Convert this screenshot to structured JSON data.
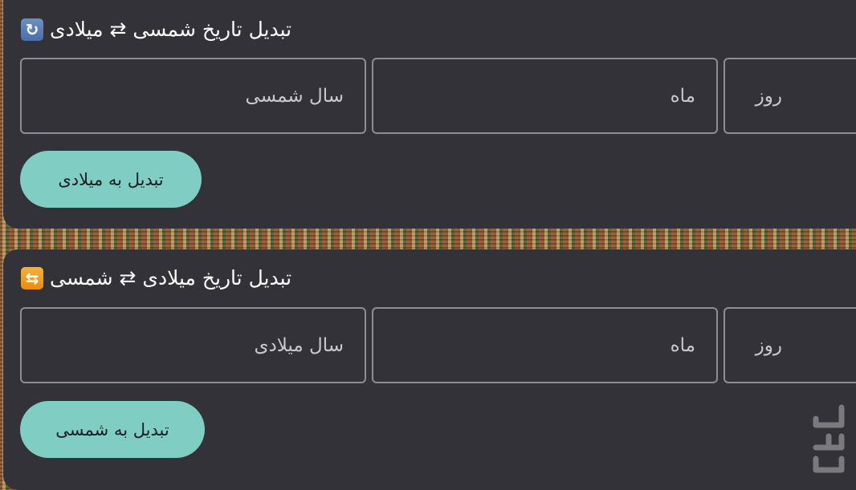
{
  "sections": [
    {
      "title": "تبدیل تاریخ شمسی ⇄ میلادی",
      "icon": "refresh-icon",
      "year_placeholder": "سال شمسی",
      "month_placeholder": "ماه",
      "day_placeholder": "روز",
      "button_label": "تبدیل به میلادی"
    },
    {
      "title": "تبدیل تاریخ میلادی ⇄ شمسی",
      "icon": "repeat-icon",
      "year_placeholder": "سال میلادی",
      "month_placeholder": "ماه",
      "day_placeholder": "روز",
      "button_label": "تبدیل به شمسی"
    }
  ],
  "colors": {
    "card_bg": "#333238",
    "button_bg": "#7fcdc3",
    "field_border": "#8e8d92"
  },
  "watermark_icon": "cafebazaar-logo-icon"
}
